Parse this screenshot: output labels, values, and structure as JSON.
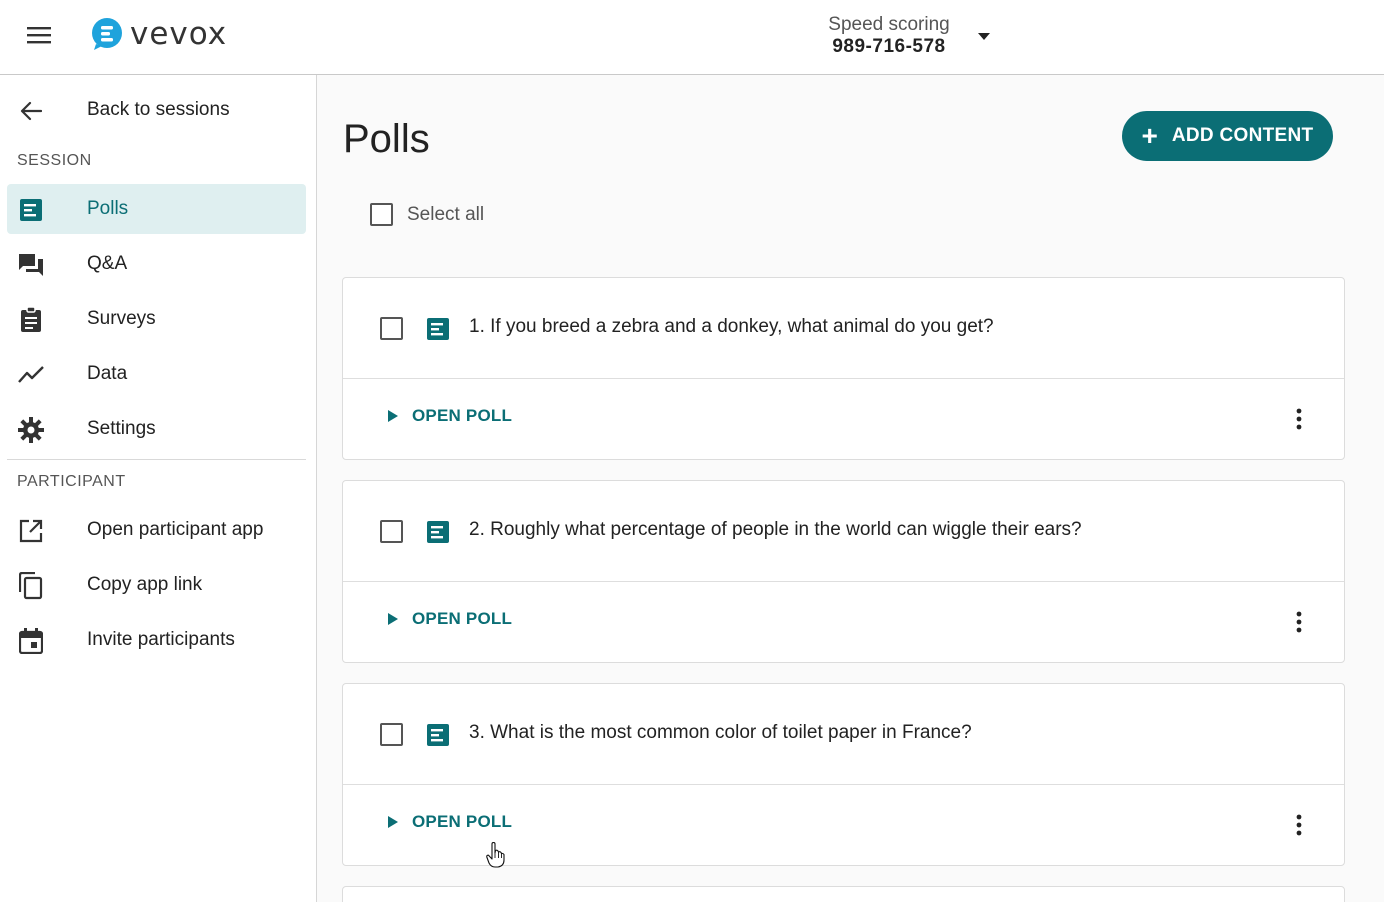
{
  "header": {
    "logo_text": "vevox",
    "session_name": "Speed scoring",
    "session_code": "989-716-578"
  },
  "sidebar": {
    "back_label": "Back to sessions",
    "session_section": "SESSION",
    "session_items": [
      {
        "label": "Polls",
        "icon": "poll-icon",
        "active": true
      },
      {
        "label": "Q&A",
        "icon": "qa-icon"
      },
      {
        "label": "Surveys",
        "icon": "survey-icon"
      },
      {
        "label": "Data",
        "icon": "chart-icon"
      },
      {
        "label": "Settings",
        "icon": "gear-icon"
      }
    ],
    "participant_section": "PARTICIPANT",
    "participant_items": [
      {
        "label": "Open participant app",
        "icon": "open-in-new-icon"
      },
      {
        "label": "Copy app link",
        "icon": "copy-icon"
      },
      {
        "label": "Invite participants",
        "icon": "calendar-icon"
      }
    ]
  },
  "main": {
    "title": "Polls",
    "add_content_label": "ADD CONTENT",
    "select_all_label": "Select all",
    "polls": [
      {
        "question": "1. If you breed a zebra and a donkey, what animal do you get?",
        "action": "OPEN POLL"
      },
      {
        "question": "2. Roughly what percentage of people in the world can wiggle their ears?",
        "action": "OPEN POLL"
      },
      {
        "question": "3. What is the most common color of toilet paper in France?",
        "action": "OPEN POLL"
      }
    ]
  },
  "colors": {
    "accent": "#0b6e75",
    "active_bg": "#dfeff0",
    "logo_blue": "#1fa3dc"
  }
}
